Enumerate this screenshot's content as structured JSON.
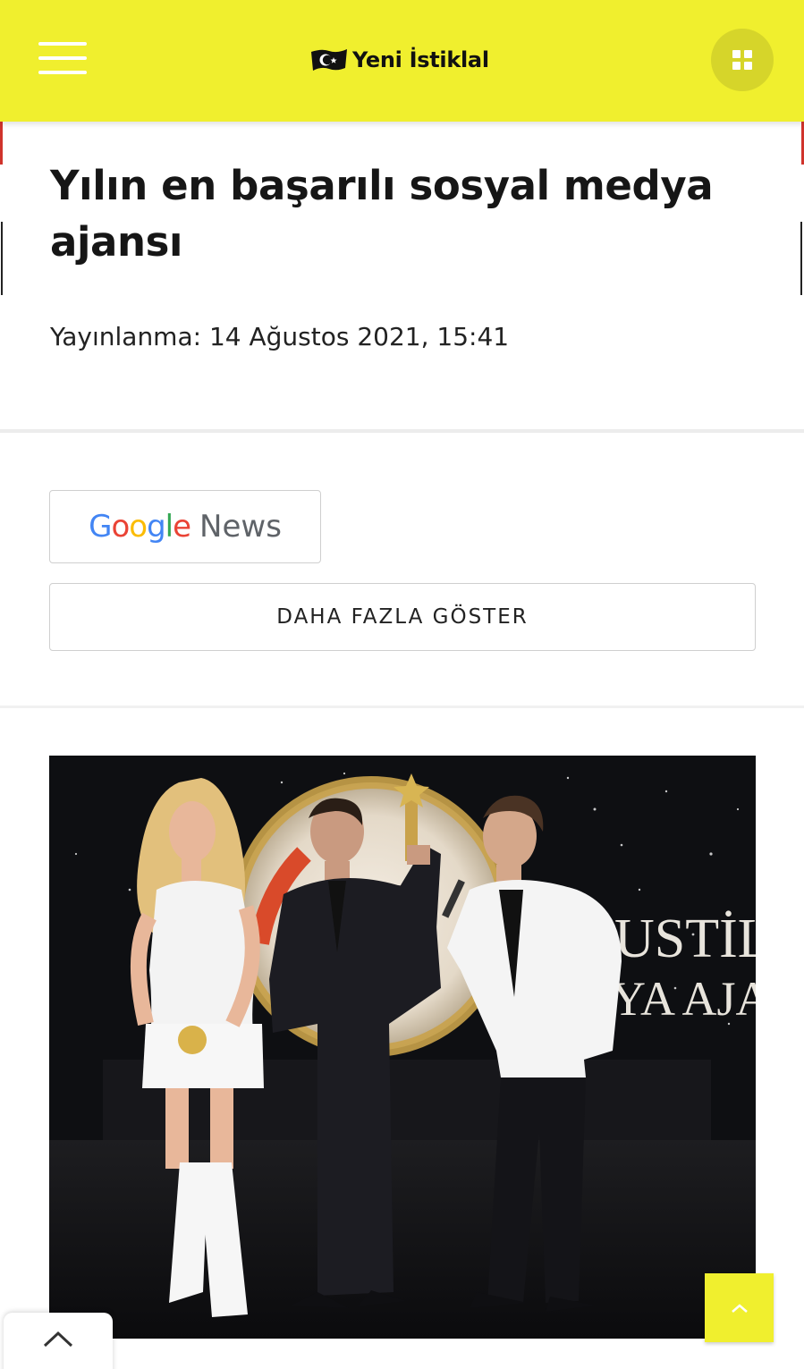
{
  "header": {
    "site_name": "Yeni İstiklal",
    "background_color": "#f0ef2e",
    "menu_icon": "hamburger-menu-icon",
    "apps_icon": "grid-apps-icon"
  },
  "article": {
    "title": "Yılın en başarılı sosyal medya ajansı",
    "published": "Yayınlanma: 14 Ağustos 2021, 15:41"
  },
  "buttons": {
    "google_news_google": "Google",
    "google_news_news": "News",
    "more": "DAHA FAZLA GÖSTER"
  },
  "photo": {
    "stage_text_line1": "USTİLİ",
    "stage_text_line2": "YA AJAN"
  },
  "controls": {
    "back_to_top_icon": "chevron-up-icon",
    "collapse_tab_icon": "chevron-up-icon"
  }
}
